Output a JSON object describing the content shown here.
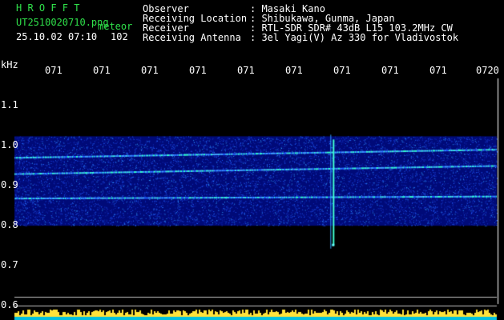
{
  "app": {
    "title": "H R O F F T",
    "filename": "UT2510020710.png",
    "mode": "meteor",
    "datetime": "25.10.02 07:10",
    "count": "102"
  },
  "info": {
    "labels": [
      "Observer",
      "Receiving Location",
      "Receiver",
      "Receiving Antenna"
    ],
    "values": [
      ": Masaki Kano",
      ": Shibukawa, Gunma, Japan",
      ": RTL-SDR SDR# 43dB L15 103.2MHz CW",
      ": 3el Yagi(V) Az 330 for Vladivostok"
    ]
  },
  "axis": {
    "unit": "kHz",
    "y_ticks": [
      "1.1",
      "1.0",
      "0.9",
      "0.8",
      "0.7",
      "0.6"
    ],
    "time_ticks": [
      "071",
      "071",
      "071",
      "071",
      "071",
      "071",
      "071",
      "071",
      "071",
      "0720"
    ]
  },
  "colors": {
    "title": "#2fe04a",
    "text": "#ffffff",
    "time_labels": "#ffe23a",
    "background": "#000000",
    "spectrogram_base": "#000a78"
  },
  "chart_data": {
    "type": "heatmap",
    "xlabel": "",
    "ylabel": "kHz",
    "ylim": [
      0.6,
      1.15
    ],
    "x_ticks": [
      "071",
      "071",
      "071",
      "071",
      "071",
      "071",
      "071",
      "071",
      "071",
      "0720"
    ],
    "traces": [
      {
        "kHz_start": 0.955,
        "kHz_end": 0.975
      },
      {
        "kHz_start": 0.915,
        "kHz_end": 0.935
      },
      {
        "kHz_start": 0.855,
        "kHz_end": 0.86
      }
    ],
    "meteor_event": {
      "time_fraction": 0.66,
      "kHz_from": 0.74,
      "kHz_to": 1.0
    }
  }
}
